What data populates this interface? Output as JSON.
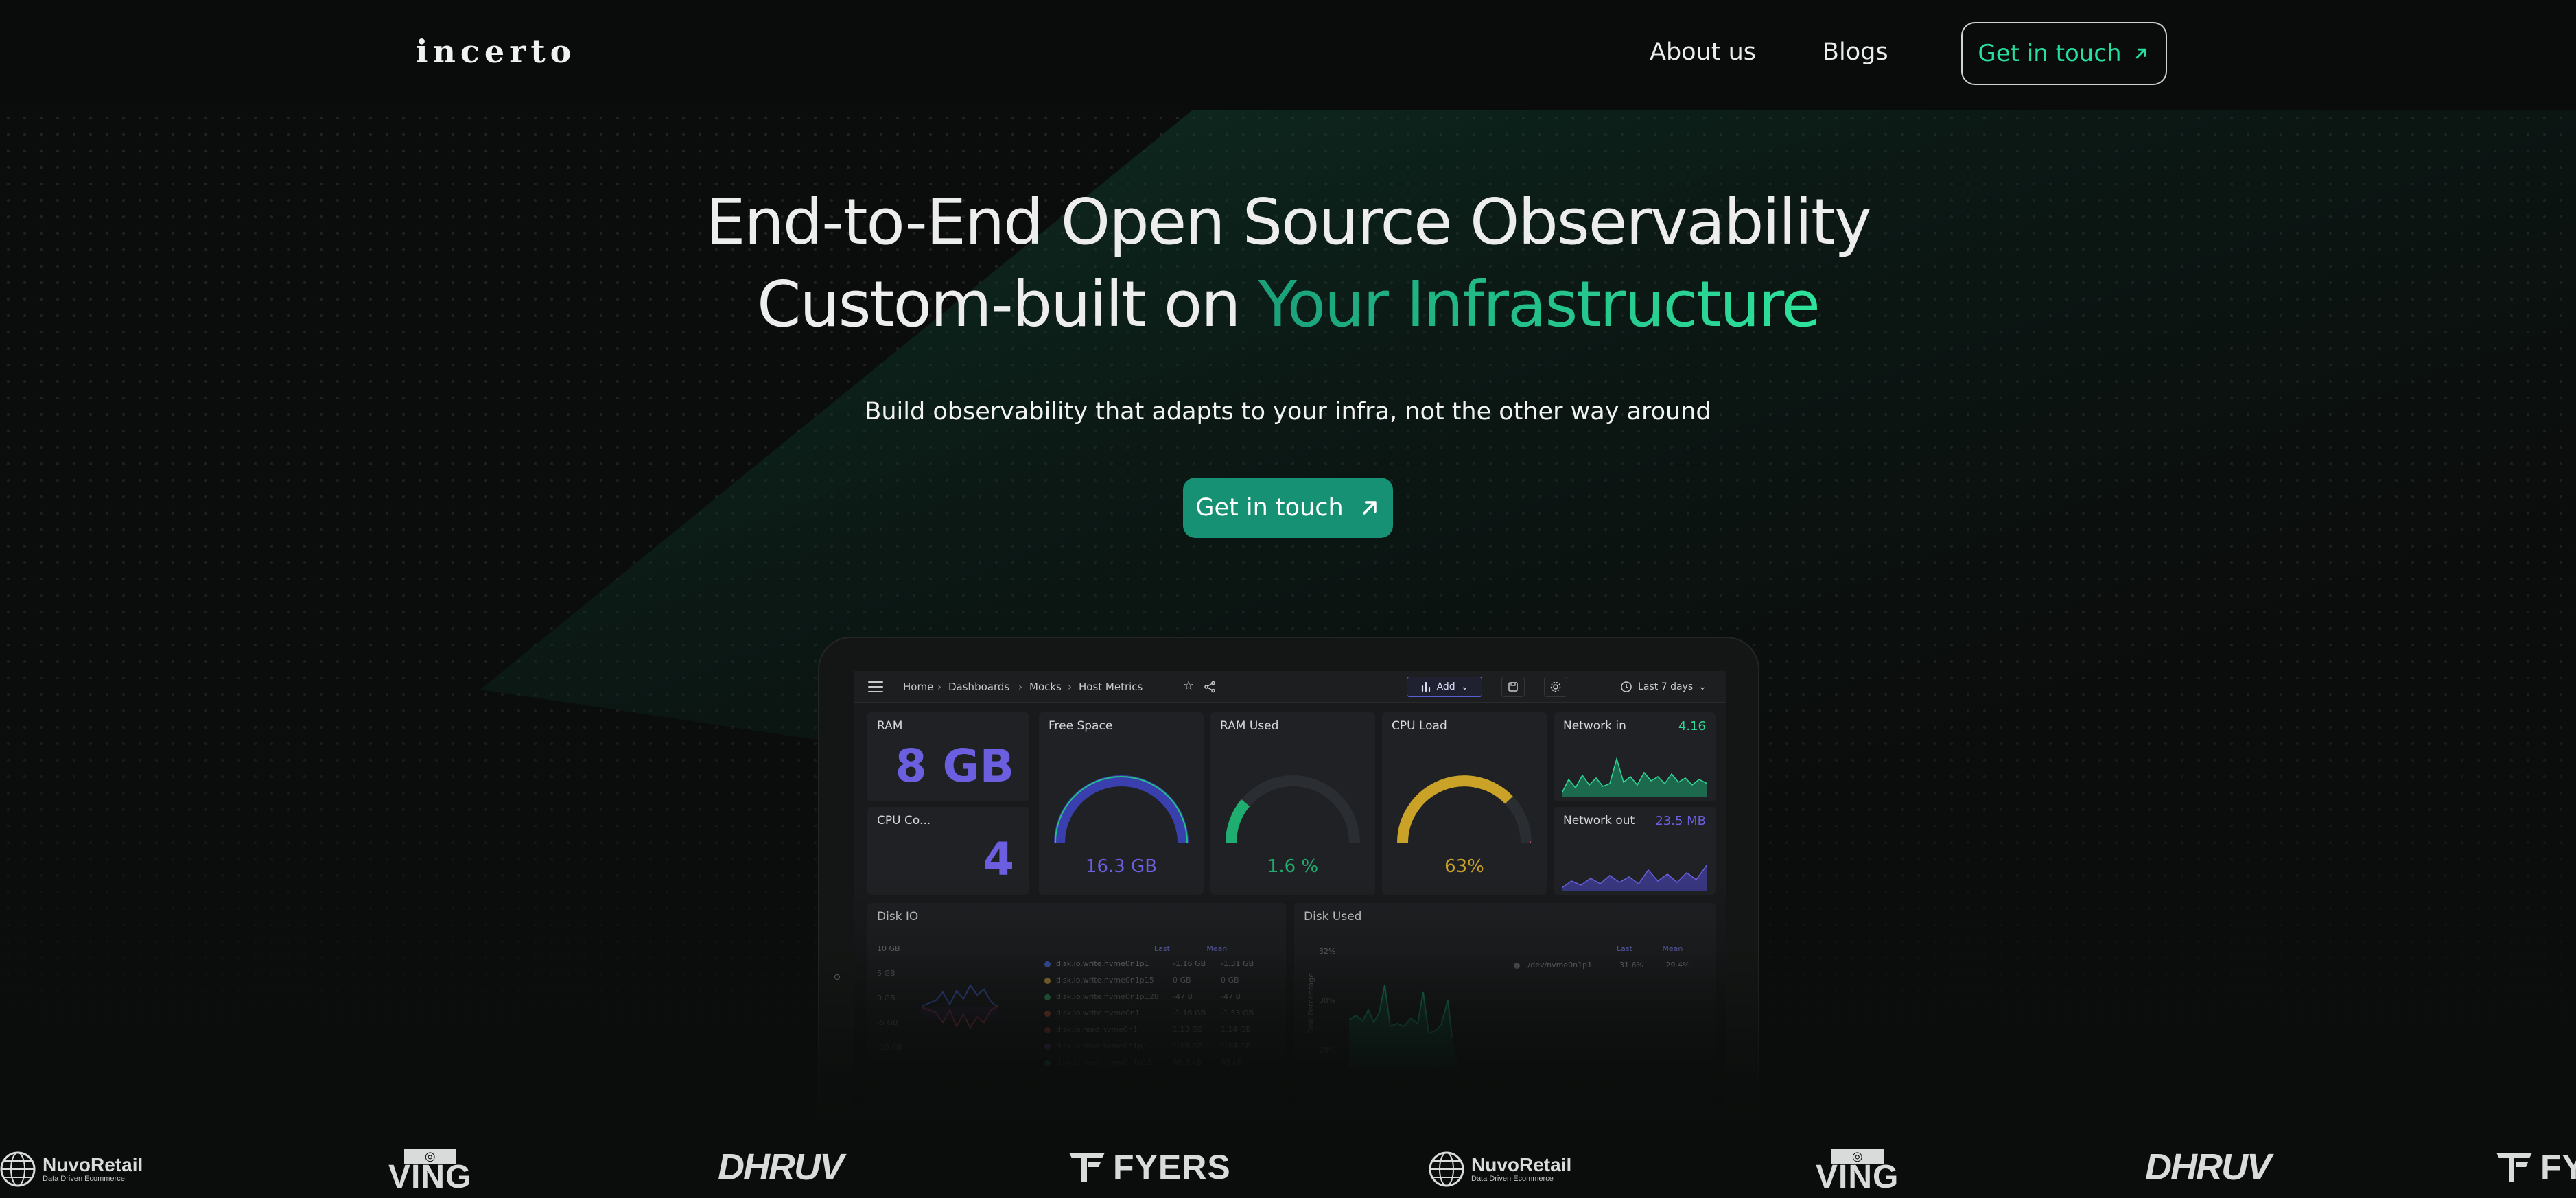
{
  "header": {
    "logo": "incerto",
    "nav": [
      "About us",
      "Blogs"
    ],
    "cta_label": "Get in touch"
  },
  "hero": {
    "title_line1": "End-to-End Open Source Observability",
    "title_line2_prefix": "Custom-built on",
    "title_line2_accent": "Your Infrastructure",
    "subtitle": "Build observability that adapts to your infra, not the other way around",
    "cta_label": "Get in touch"
  },
  "dashboard": {
    "breadcrumb": [
      "Home",
      "Dashboards",
      "Mocks",
      "Host Metrics"
    ],
    "add_label": "Add",
    "time_range": "Last 7 days",
    "panels": {
      "ram": {
        "title": "RAM",
        "value": "8 GB"
      },
      "cpu_cores": {
        "title": "CPU Co...",
        "value": "4"
      },
      "free_space": {
        "title": "Free Space",
        "value": "16.3 GB"
      },
      "ram_used": {
        "title": "RAM Used",
        "value": "1.6 %"
      },
      "cpu_load": {
        "title": "CPU Load",
        "value": "63%"
      },
      "network_in": {
        "title": "Network in",
        "value": "4.16"
      },
      "network_out": {
        "title": "Network out",
        "value": "23.5 MB"
      },
      "disk_io": {
        "title": "Disk IO",
        "legend_headers": [
          "Last",
          "Mean"
        ],
        "y_ticks": [
          "10 GB",
          "5 GB",
          "0 GB",
          "-5 GB",
          "-10 GB"
        ],
        "rows": [
          {
            "name": "disk.io.write.nvme0n1p1",
            "last": "-1.16 GB",
            "mean": "-1.31 GB",
            "color": "#4f6fe8"
          },
          {
            "name": "disk.io.write.nvme0n1p15",
            "last": "0 GB",
            "mean": "0 GB",
            "color": "#e8b84f"
          },
          {
            "name": "disk.io.write.nvme0n1p128",
            "last": "-47 B",
            "mean": "-47 B",
            "color": "#49c58a"
          },
          {
            "name": "disk.io.write.nvme0n1",
            "last": "-1.16 GB",
            "mean": "-1.53 GB",
            "color": "#e86f4f"
          },
          {
            "name": "disk.io.read.nvme0n1",
            "last": "1.13 GB",
            "mean": "1.14 GB",
            "color": "#d65252"
          },
          {
            "name": "disk.io.read.nvme0n1p1",
            "last": "1.13 GB",
            "mean": "1.14 GB",
            "color": "#b04fe8"
          },
          {
            "name": "disk.io.read.nvme0n1p15",
            "last": "96.3 kB",
            "mean": "95 kB",
            "color": "#4fc7e8"
          }
        ]
      },
      "disk_used": {
        "title": "Disk Used",
        "legend_headers": [
          "Last",
          "Mean"
        ],
        "y_ticks": [
          "32%",
          "30%",
          "28%"
        ],
        "y_axis_label": "Disk Percentage",
        "rows": [
          {
            "name": "/dev/nvme0n1p1",
            "last": "31.6%",
            "mean": "29.4%",
            "color": "#6d6f74"
          }
        ]
      }
    }
  },
  "clients": [
    {
      "type": "nuvo",
      "name": "NuvoRetail",
      "tagline": "Data Driven Ecommerce"
    },
    {
      "type": "ving",
      "name": "VING"
    },
    {
      "type": "dhruv",
      "name": "DHRUV"
    },
    {
      "type": "fyers",
      "name": "FYERS"
    },
    {
      "type": "nuvo",
      "name": "NuvoRetail",
      "tagline": "Data Driven Ecommerce"
    },
    {
      "type": "ving",
      "name": "VING"
    },
    {
      "type": "dhruv",
      "name": "DHRUV"
    },
    {
      "type": "fyers",
      "name": "FYERS"
    }
  ],
  "colors": {
    "accent": "#20c48e",
    "cta_bg": "#179173",
    "stat_purple": "#6b5fe0",
    "gauge_green": "#1fae70",
    "gauge_gold": "#c9a227"
  }
}
